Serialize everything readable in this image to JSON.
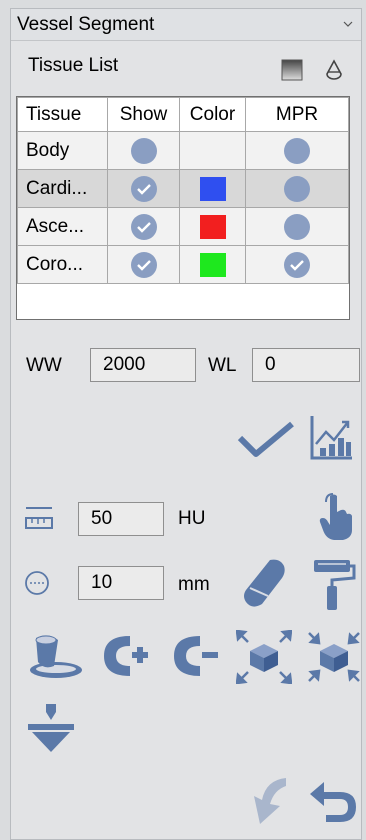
{
  "panel": {
    "title": "Vessel Segment",
    "tissue_list_label": "Tissue List"
  },
  "table": {
    "headers": [
      "Tissue",
      "Show",
      "Color",
      "MPR"
    ],
    "rows": [
      {
        "name": "Body",
        "show": false,
        "color": null,
        "mpr": false
      },
      {
        "name": "Cardi...",
        "show": true,
        "color": "#2f4ff0",
        "mpr": false
      },
      {
        "name": "Asce...",
        "show": true,
        "color": "#f21f1f",
        "mpr": false
      },
      {
        "name": "Coro...",
        "show": true,
        "color": "#1ee81e",
        "mpr": true
      }
    ]
  },
  "window": {
    "ww_label": "WW",
    "ww_value": "2000",
    "wl_label": "WL",
    "wl_value": "0"
  },
  "threshold": {
    "value": "50",
    "unit": "HU"
  },
  "radius": {
    "value": "10",
    "unit": "mm"
  },
  "colors": {
    "accent": "#5b79a8",
    "dot": "#8a9ec2"
  }
}
